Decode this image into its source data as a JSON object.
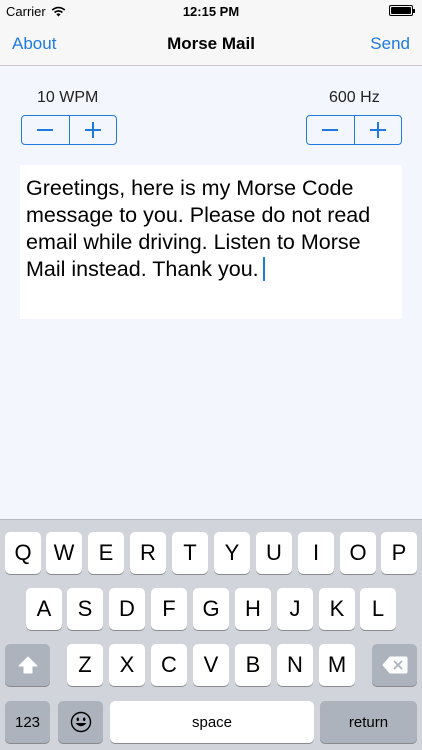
{
  "status_bar": {
    "carrier": "Carrier",
    "time": "12:15 PM"
  },
  "nav": {
    "left": "About",
    "title": "Morse Mail",
    "right": "Send"
  },
  "controls": {
    "speed_label": "10 WPM",
    "tone_label": "600 Hz"
  },
  "message": {
    "text": "Greetings, here is my Morse Code message to you. Please do not read email while driving. Listen to Morse Mail instead. Thank you."
  },
  "keyboard": {
    "row1": [
      "Q",
      "W",
      "E",
      "R",
      "T",
      "Y",
      "U",
      "I",
      "O",
      "P"
    ],
    "row2": [
      "A",
      "S",
      "D",
      "F",
      "G",
      "H",
      "J",
      "K",
      "L"
    ],
    "row3": [
      "Z",
      "X",
      "C",
      "V",
      "B",
      "N",
      "M"
    ],
    "numbers": "123",
    "space": "space",
    "return": "return"
  },
  "colors": {
    "accent": "#1f7ae0",
    "background": "#f3f6fd",
    "keyboard": "#d1d5db"
  }
}
